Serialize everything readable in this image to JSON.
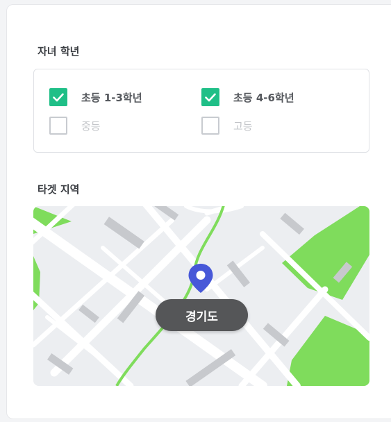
{
  "grade_section": {
    "title": "자녀 학년",
    "options": [
      {
        "label": "초등 1-3학년",
        "checked": true
      },
      {
        "label": "초등 4-6학년",
        "checked": true
      },
      {
        "label": "중등",
        "checked": false
      },
      {
        "label": "고등",
        "checked": false
      }
    ]
  },
  "region_section": {
    "title": "타겟 지역",
    "selected_region": "경기도"
  },
  "colors": {
    "check_accent": "#1fbf87",
    "pin": "#4758d8",
    "park": "#7fdc5c",
    "road": "#ffffff",
    "map_bg": "#eceef1",
    "building": "#c7c9cd"
  },
  "icons": {
    "checked": "checkmark-icon",
    "pin": "map-pin-icon"
  }
}
